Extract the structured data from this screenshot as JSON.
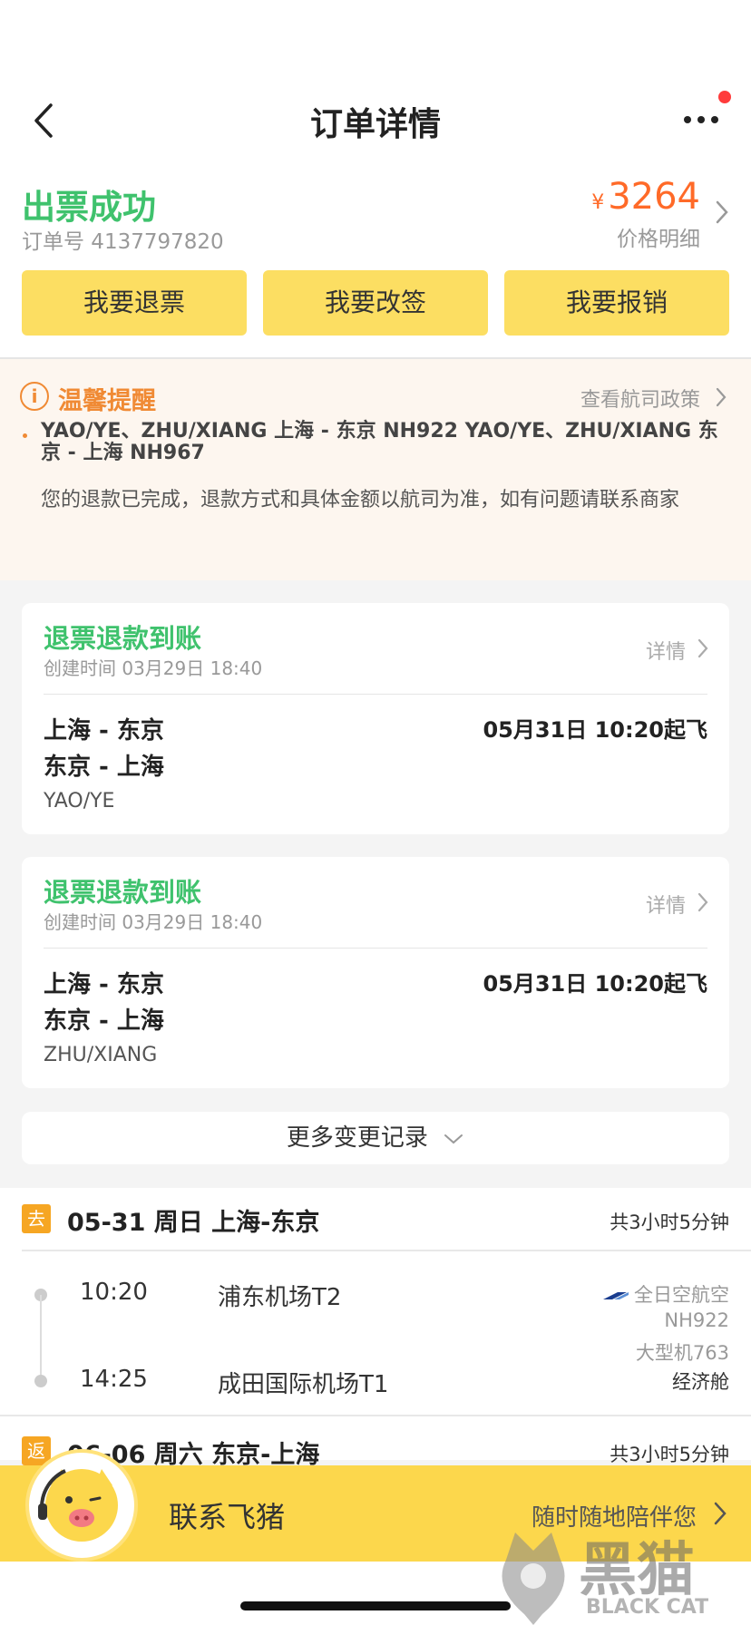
{
  "header": {
    "title": "订单详情"
  },
  "status": {
    "title": "出票成功",
    "order_no": "订单号 4137797820",
    "currency": "¥",
    "price": "3264",
    "price_detail": "价格明细"
  },
  "actions": [
    "我要退票",
    "我要改签",
    "我要报销"
  ],
  "notice": {
    "title": "温馨提醒",
    "link": "查看航司政策",
    "line1": "YAO/YE、ZHU/XIANG 上海 - 东京 NH922 YAO/YE、ZHU/XIANG 东京 - 上海 NH967",
    "line2": "您的退款已完成，退款方式和具体金额以航司为准，如有问题请联系商家"
  },
  "refunds": [
    {
      "title": "退票退款到账",
      "created": "创建时间 03月29日 18:40",
      "detail": "详情",
      "route1": "上海 - 东京",
      "route2": "东京 - 上海",
      "depart": "05月31日 10:20起飞",
      "passenger": "YAO/YE"
    },
    {
      "title": "退票退款到账",
      "created": "创建时间 03月29日 18:40",
      "detail": "详情",
      "route1": "上海 - 东京",
      "route2": "东京 - 上海",
      "depart": "05月31日 10:20起飞",
      "passenger": "ZHU/XIANG"
    }
  ],
  "more_records": "更多变更记录",
  "flights": [
    {
      "tag": "去",
      "header": "05-31 周日 上海-东京",
      "duration": "共3小时5分钟",
      "dep_time": "10:20",
      "dep_airport": "浦东机场T2",
      "arr_time": "14:25",
      "arr_airport": "成田国际机场T1",
      "airline": "全日空航空",
      "flight_no": "NH922",
      "aircraft": "大型机763",
      "cabin": "经济舱"
    },
    {
      "tag": "返",
      "header": "06-06 周六 东京-上海",
      "duration": "共3小时5分钟"
    }
  ],
  "contact": {
    "label": "联系飞猪",
    "sub": "随时随地陪伴您"
  },
  "watermark": {
    "main": "黑猫",
    "sub": "BLACK CAT"
  },
  "colors": {
    "accent_yellow": "#fcde62",
    "success_green": "#3fc26d",
    "price_orange": "#ff6a28",
    "notice_orange": "#f08a34"
  }
}
